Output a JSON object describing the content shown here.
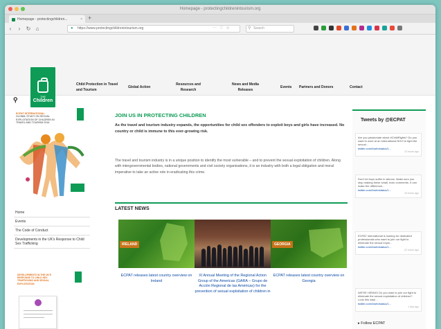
{
  "browser": {
    "window_title": "Homepage - protectingchildrenintourism.org",
    "tab_label": "Homepage - protectingchildren...",
    "url": "https://www.protectingchildrenintourism.org",
    "search_placeholder": "Search"
  },
  "site": {
    "logo_small": "THE",
    "logo_text": "Children",
    "nav": [
      "Child Protection in Travel and Tourism",
      "Global Action",
      "Resources and Research",
      "News and Media Releases",
      "Events",
      "Partners and Donors",
      "Contact"
    ]
  },
  "sidebar": {
    "promo_org": "ECPAT INTERNATIONAL",
    "promo_title": "GLOBAL STUDY ON SEXUAL EXPLOITATION OF CHILDREN IN TRAVEL AND TOURISM 2016",
    "nav": [
      "Home",
      "Events",
      "The Code of Conduct",
      "Developments in the UK's Response to Child Sex Trafficking"
    ],
    "promo2_title": "DEVELOPMENTS IN THE UK'S RESPONSE TO CHILD SEX TRAFFICKING AND SEXUAL EXPLOITATION"
  },
  "main": {
    "heading": "JOIN US IN PROTECTING CHILDREN",
    "lead": "As the travel and tourism industry expands, the opportunities for child sex offenders to exploit boys and girls have increased. No country or child is immune to this ever-growing risk.",
    "body": "The travel and tourism industry is in a unique position to identify the most vulnerable – and to prevent the sexual exploitation of children. Along with intergovernmental bodies, national governments and civil society organisations, it is an industry with both a legal obligation and moral imperative to take an active role in eradicating this crime.",
    "latest_heading": "LATEST NEWS",
    "news": [
      {
        "tag": "IRELAND",
        "caption": "ECPAT releases latest country overview on Ireland"
      },
      {
        "tag": "",
        "caption": "XI Annual Meeting of the Regional Action Group of the Americas (GARA – Grupo de Acción Regional de las Américas) for the prevention of sexual exploitation of children in"
      },
      {
        "tag": "GEORGIA",
        "caption": "ECPAT releases latest country overview on Georgia"
      }
    ]
  },
  "tweets": {
    "heading": "Tweets by @ECPAT",
    "items": [
      {
        "text": "Are you passionate about #ChildRights? Do you want to work at an international NGO to fight the sexual...",
        "link": "twitter.com/i/web/status/1...",
        "time": "13 hours ago"
      },
      {
        "text": "Don't let boys suffer in silence. Make sure you stop making these small, toxic comments. It can make the difference...",
        "link": "twitter.com/i/web/status/1...",
        "time": "18 hours ago"
      },
      {
        "text": "ECPAT International is looking for dedicated professionals who want to join our fight to eliminate the sexual explo...",
        "link": "twitter.com/i/web/status/1...",
        "time": "22 hours ago"
      },
      {
        "text": "WE'RE HIRING! Do you want to join our fight to eliminate the sexual exploitation of children? Look this way!...",
        "link": "twitter.com/i/web/status/1...",
        "time": "1 day ago"
      }
    ],
    "follow": "Follow ECPAT"
  }
}
